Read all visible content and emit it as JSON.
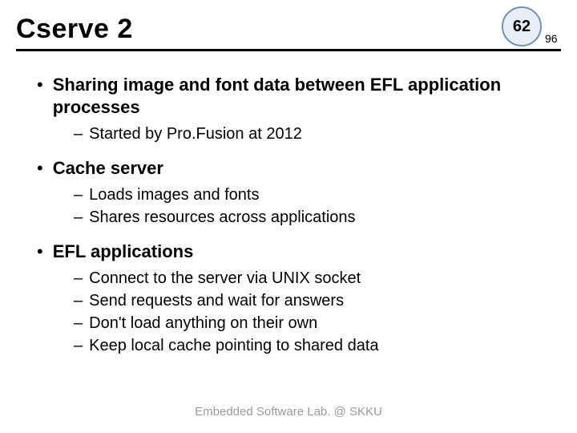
{
  "title": "Cserve 2",
  "badge": {
    "main": "62",
    "sub": "96"
  },
  "bullets": [
    {
      "text": "Sharing image and font data between EFL application processes",
      "sub": [
        "Started by Pro.Fusion at 2012"
      ]
    },
    {
      "text": "Cache server",
      "sub": [
        "Loads images and fonts",
        "Shares resources across applications"
      ]
    },
    {
      "text": "EFL applications",
      "sub": [
        "Connect to the server via UNIX socket",
        "Send requests and wait for answers",
        "Don't load anything on their own",
        "Keep local cache pointing to shared data"
      ]
    }
  ],
  "footer": "Embedded Software Lab. @ SKKU"
}
